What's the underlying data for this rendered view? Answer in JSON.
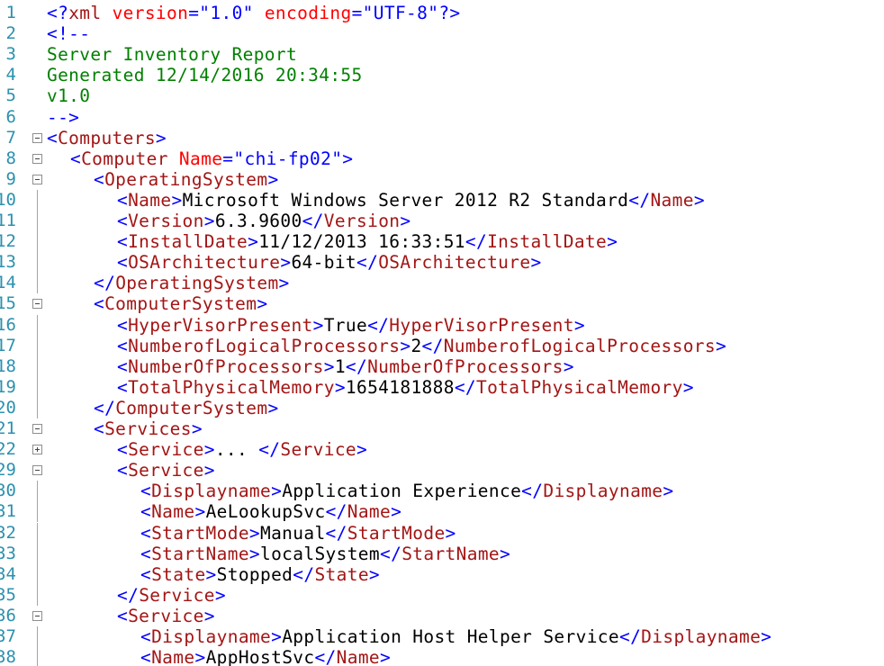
{
  "editor": {
    "lines": [
      {
        "n": "1",
        "indent": 0,
        "fold": "none",
        "guide": false,
        "segs": [
          [
            "lb",
            "<?"
          ],
          [
            "tg",
            "xml"
          ],
          [
            "tx",
            " "
          ],
          [
            "at",
            "version"
          ],
          [
            "lb",
            "="
          ],
          [
            "vl",
            "\"1.0\""
          ],
          [
            "tx",
            " "
          ],
          [
            "at",
            "encoding"
          ],
          [
            "lb",
            "="
          ],
          [
            "vl",
            "\"UTF-8\""
          ],
          [
            "lb",
            "?>"
          ]
        ]
      },
      {
        "n": "2",
        "indent": 0,
        "fold": "none",
        "guide": false,
        "segs": [
          [
            "lb",
            "<!--"
          ]
        ]
      },
      {
        "n": "3",
        "indent": 0,
        "fold": "none",
        "guide": false,
        "segs": [
          [
            "cm",
            "Server Inventory Report"
          ]
        ]
      },
      {
        "n": "4",
        "indent": 0,
        "fold": "none",
        "guide": false,
        "segs": [
          [
            "cm",
            "Generated 12/14/2016 20:34:55"
          ]
        ]
      },
      {
        "n": "5",
        "indent": 0,
        "fold": "none",
        "guide": false,
        "segs": [
          [
            "cm",
            "v1.0"
          ]
        ]
      },
      {
        "n": "6",
        "indent": 0,
        "fold": "none",
        "guide": false,
        "segs": [
          [
            "lb",
            "-->"
          ]
        ]
      },
      {
        "n": "7",
        "indent": 0,
        "fold": "minus",
        "guide": false,
        "segs": [
          [
            "lb",
            "<"
          ],
          [
            "tg",
            "Computers"
          ],
          [
            "lb",
            ">"
          ]
        ]
      },
      {
        "n": "8",
        "indent": 1,
        "fold": "minus",
        "guide": false,
        "segs": [
          [
            "lb",
            "<"
          ],
          [
            "tg",
            "Computer"
          ],
          [
            "tx",
            " "
          ],
          [
            "at",
            "Name"
          ],
          [
            "lb",
            "="
          ],
          [
            "vl",
            "\"chi-fp02\""
          ],
          [
            "lb",
            ">"
          ]
        ]
      },
      {
        "n": "9",
        "indent": 2,
        "fold": "minus",
        "guide": false,
        "segs": [
          [
            "lb",
            "<"
          ],
          [
            "tg",
            "OperatingSystem"
          ],
          [
            "lb",
            ">"
          ]
        ]
      },
      {
        "n": "10",
        "indent": 3,
        "fold": "none",
        "guide": true,
        "segs": [
          [
            "lb",
            "<"
          ],
          [
            "tg",
            "Name"
          ],
          [
            "lb",
            ">"
          ],
          [
            "tx",
            "Microsoft Windows Server 2012 R2 Standard"
          ],
          [
            "lb",
            "</"
          ],
          [
            "tg",
            "Name"
          ],
          [
            "lb",
            ">"
          ]
        ]
      },
      {
        "n": "11",
        "indent": 3,
        "fold": "none",
        "guide": true,
        "segs": [
          [
            "lb",
            "<"
          ],
          [
            "tg",
            "Version"
          ],
          [
            "lb",
            ">"
          ],
          [
            "tx",
            "6.3.9600"
          ],
          [
            "lb",
            "</"
          ],
          [
            "tg",
            "Version"
          ],
          [
            "lb",
            ">"
          ]
        ]
      },
      {
        "n": "12",
        "indent": 3,
        "fold": "none",
        "guide": true,
        "segs": [
          [
            "lb",
            "<"
          ],
          [
            "tg",
            "InstallDate"
          ],
          [
            "lb",
            ">"
          ],
          [
            "tx",
            "11/12/2013 16:33:51"
          ],
          [
            "lb",
            "</"
          ],
          [
            "tg",
            "InstallDate"
          ],
          [
            "lb",
            ">"
          ]
        ]
      },
      {
        "n": "13",
        "indent": 3,
        "fold": "none",
        "guide": true,
        "segs": [
          [
            "lb",
            "<"
          ],
          [
            "tg",
            "OSArchitecture"
          ],
          [
            "lb",
            ">"
          ],
          [
            "tx",
            "64-bit"
          ],
          [
            "lb",
            "</"
          ],
          [
            "tg",
            "OSArchitecture"
          ],
          [
            "lb",
            ">"
          ]
        ]
      },
      {
        "n": "14",
        "indent": 2,
        "fold": "none",
        "guide": true,
        "segs": [
          [
            "lb",
            "</"
          ],
          [
            "tg",
            "OperatingSystem"
          ],
          [
            "lb",
            ">"
          ]
        ]
      },
      {
        "n": "15",
        "indent": 2,
        "fold": "minus",
        "guide": false,
        "segs": [
          [
            "lb",
            "<"
          ],
          [
            "tg",
            "ComputerSystem"
          ],
          [
            "lb",
            ">"
          ]
        ]
      },
      {
        "n": "16",
        "indent": 3,
        "fold": "none",
        "guide": true,
        "segs": [
          [
            "lb",
            "<"
          ],
          [
            "tg",
            "HyperVisorPresent"
          ],
          [
            "lb",
            ">"
          ],
          [
            "tx",
            "True"
          ],
          [
            "lb",
            "</"
          ],
          [
            "tg",
            "HyperVisorPresent"
          ],
          [
            "lb",
            ">"
          ]
        ]
      },
      {
        "n": "17",
        "indent": 3,
        "fold": "none",
        "guide": true,
        "segs": [
          [
            "lb",
            "<"
          ],
          [
            "tg",
            "NumberofLogicalProcessors"
          ],
          [
            "lb",
            ">"
          ],
          [
            "tx",
            "2"
          ],
          [
            "lb",
            "</"
          ],
          [
            "tg",
            "NumberofLogicalProcessors"
          ],
          [
            "lb",
            ">"
          ]
        ]
      },
      {
        "n": "18",
        "indent": 3,
        "fold": "none",
        "guide": true,
        "segs": [
          [
            "lb",
            "<"
          ],
          [
            "tg",
            "NumberOfProcessors"
          ],
          [
            "lb",
            ">"
          ],
          [
            "tx",
            "1"
          ],
          [
            "lb",
            "</"
          ],
          [
            "tg",
            "NumberOfProcessors"
          ],
          [
            "lb",
            ">"
          ]
        ]
      },
      {
        "n": "19",
        "indent": 3,
        "fold": "none",
        "guide": true,
        "segs": [
          [
            "lb",
            "<"
          ],
          [
            "tg",
            "TotalPhysicalMemory"
          ],
          [
            "lb",
            ">"
          ],
          [
            "tx",
            "1654181888"
          ],
          [
            "lb",
            "</"
          ],
          [
            "tg",
            "TotalPhysicalMemory"
          ],
          [
            "lb",
            ">"
          ]
        ]
      },
      {
        "n": "20",
        "indent": 2,
        "fold": "none",
        "guide": true,
        "segs": [
          [
            "lb",
            "</"
          ],
          [
            "tg",
            "ComputerSystem"
          ],
          [
            "lb",
            ">"
          ]
        ]
      },
      {
        "n": "21",
        "indent": 2,
        "fold": "minus",
        "guide": false,
        "segs": [
          [
            "lb",
            "<"
          ],
          [
            "tg",
            "Services"
          ],
          [
            "lb",
            ">"
          ]
        ]
      },
      {
        "n": "22",
        "indent": 3,
        "fold": "plus",
        "guide": false,
        "segs": [
          [
            "lb",
            "<"
          ],
          [
            "tg",
            "Service"
          ],
          [
            "lb",
            ">"
          ],
          [
            "tx",
            "..."
          ],
          [
            "tx",
            " "
          ],
          [
            "lb",
            "</"
          ],
          [
            "tg",
            "Service"
          ],
          [
            "lb",
            ">"
          ]
        ]
      },
      {
        "n": "29",
        "indent": 3,
        "fold": "minus",
        "guide": false,
        "segs": [
          [
            "lb",
            "<"
          ],
          [
            "tg",
            "Service"
          ],
          [
            "lb",
            ">"
          ]
        ]
      },
      {
        "n": "30",
        "indent": 4,
        "fold": "none",
        "guide": true,
        "segs": [
          [
            "lb",
            "<"
          ],
          [
            "tg",
            "Displayname"
          ],
          [
            "lb",
            ">"
          ],
          [
            "tx",
            "Application Experience"
          ],
          [
            "lb",
            "</"
          ],
          [
            "tg",
            "Displayname"
          ],
          [
            "lb",
            ">"
          ]
        ]
      },
      {
        "n": "31",
        "indent": 4,
        "fold": "none",
        "guide": true,
        "segs": [
          [
            "lb",
            "<"
          ],
          [
            "tg",
            "Name"
          ],
          [
            "lb",
            ">"
          ],
          [
            "tx",
            "AeLookupSvc"
          ],
          [
            "lb",
            "</"
          ],
          [
            "tg",
            "Name"
          ],
          [
            "lb",
            ">"
          ]
        ]
      },
      {
        "n": "32",
        "indent": 4,
        "fold": "none",
        "guide": true,
        "segs": [
          [
            "lb",
            "<"
          ],
          [
            "tg",
            "StartMode"
          ],
          [
            "lb",
            ">"
          ],
          [
            "tx",
            "Manual"
          ],
          [
            "lb",
            "</"
          ],
          [
            "tg",
            "StartMode"
          ],
          [
            "lb",
            ">"
          ]
        ]
      },
      {
        "n": "33",
        "indent": 4,
        "fold": "none",
        "guide": true,
        "segs": [
          [
            "lb",
            "<"
          ],
          [
            "tg",
            "StartName"
          ],
          [
            "lb",
            ">"
          ],
          [
            "tx",
            "localSystem"
          ],
          [
            "lb",
            "</"
          ],
          [
            "tg",
            "StartName"
          ],
          [
            "lb",
            ">"
          ]
        ]
      },
      {
        "n": "34",
        "indent": 4,
        "fold": "none",
        "guide": true,
        "segs": [
          [
            "lb",
            "<"
          ],
          [
            "tg",
            "State"
          ],
          [
            "lb",
            ">"
          ],
          [
            "tx",
            "Stopped"
          ],
          [
            "lb",
            "</"
          ],
          [
            "tg",
            "State"
          ],
          [
            "lb",
            ">"
          ]
        ]
      },
      {
        "n": "35",
        "indent": 3,
        "fold": "none",
        "guide": true,
        "segs": [
          [
            "lb",
            "</"
          ],
          [
            "tg",
            "Service"
          ],
          [
            "lb",
            ">"
          ]
        ]
      },
      {
        "n": "36",
        "indent": 3,
        "fold": "minus",
        "guide": false,
        "segs": [
          [
            "lb",
            "<"
          ],
          [
            "tg",
            "Service"
          ],
          [
            "lb",
            ">"
          ]
        ]
      },
      {
        "n": "37",
        "indent": 4,
        "fold": "none",
        "guide": true,
        "segs": [
          [
            "lb",
            "<"
          ],
          [
            "tg",
            "Displayname"
          ],
          [
            "lb",
            ">"
          ],
          [
            "tx",
            "Application Host Helper Service"
          ],
          [
            "lb",
            "</"
          ],
          [
            "tg",
            "Displayname"
          ],
          [
            "lb",
            ">"
          ]
        ]
      },
      {
        "n": "38",
        "indent": 4,
        "fold": "none",
        "guide": true,
        "segs": [
          [
            "lb",
            "<"
          ],
          [
            "tg",
            "Name"
          ],
          [
            "lb",
            ">"
          ],
          [
            "tx",
            "AppHostSvc"
          ],
          [
            "lb",
            "</"
          ],
          [
            "tg",
            "Name"
          ],
          [
            "lb",
            ">"
          ]
        ]
      }
    ]
  },
  "colors": {
    "line_number": "#2b91af",
    "xml_delimiter": "#0000ff",
    "element_name": "#a31515",
    "attribute_name": "#ff0000",
    "attribute_value": "#0000ff",
    "text": "#000000",
    "comment": "#008000"
  }
}
